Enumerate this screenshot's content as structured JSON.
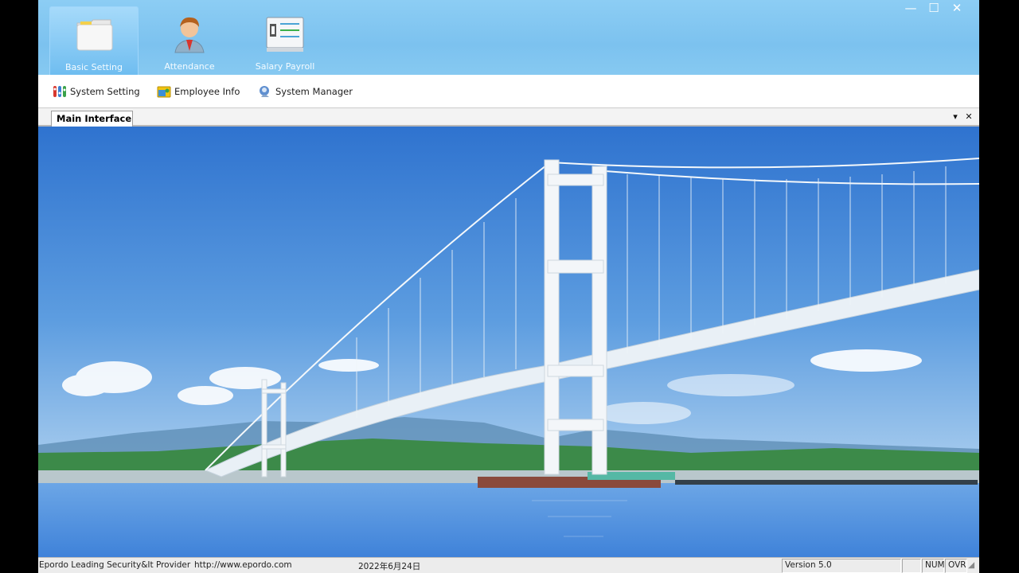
{
  "ribbon": {
    "tabs": [
      {
        "label": "Basic Setting",
        "icon": "folder-icon"
      },
      {
        "label": "Attendance",
        "icon": "person-icon"
      },
      {
        "label": "Salary Payroll",
        "icon": "payroll-panel-icon"
      }
    ],
    "window_controls": {
      "minimize": "—",
      "maximize": "☐",
      "close": "✕"
    }
  },
  "toolbar": {
    "items": [
      {
        "label": "System Setting",
        "icon": "system-setting-icon"
      },
      {
        "label": "Employee Info",
        "icon": "employee-info-icon"
      },
      {
        "label": "System Manager",
        "icon": "system-manager-icon"
      }
    ]
  },
  "document_tabs": {
    "active": "Main Interface",
    "menu_glyph": "▾",
    "close_glyph": "✕"
  },
  "main": {
    "image": "suspension-bridge-over-sea"
  },
  "status_bar": {
    "company": "Epordo Leading Security&It Provider",
    "website": "http://www.epordo.com",
    "date": "2022年6月24日",
    "version": "Version 5.0",
    "num": "NUM",
    "ovr": "OVR"
  },
  "colors": {
    "ribbon": "#7cc2ef",
    "sky_top": "#3a7fd4",
    "sea": "#4f8ee0"
  }
}
